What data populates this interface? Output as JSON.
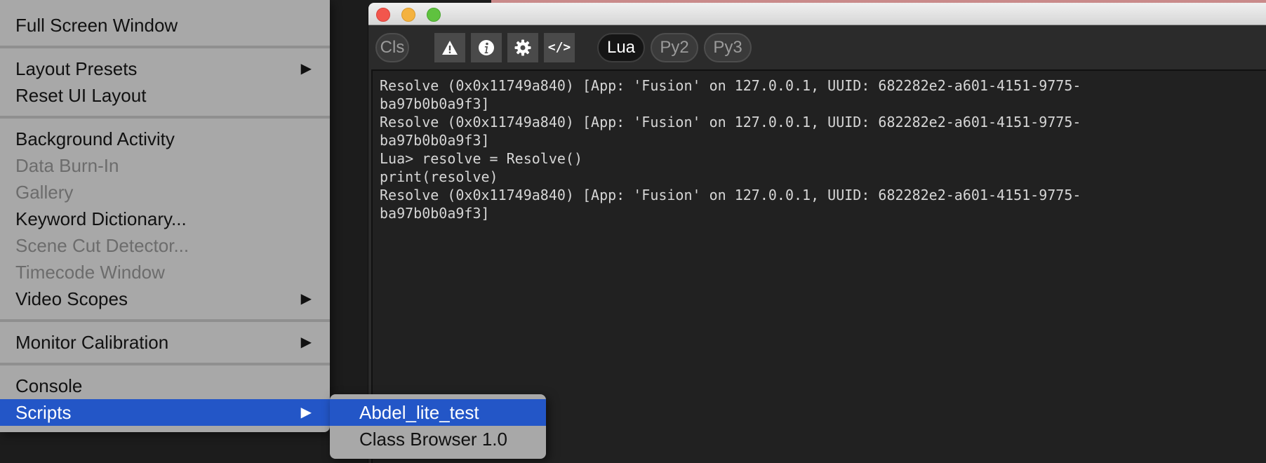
{
  "menu": {
    "items": [
      {
        "label": "Full Screen Window",
        "enabled": true
      },
      {
        "label": "Layout Presets",
        "enabled": true,
        "submenu_arrow": "▶"
      },
      {
        "label": "Reset UI Layout",
        "enabled": true
      },
      {
        "label": "Background Activity",
        "enabled": true
      },
      {
        "label": "Data Burn-In",
        "enabled": false
      },
      {
        "label": "Gallery",
        "enabled": false
      },
      {
        "label": "Keyword Dictionary...",
        "enabled": true
      },
      {
        "label": "Scene Cut Detector...",
        "enabled": false
      },
      {
        "label": "Timecode Window",
        "enabled": false
      },
      {
        "label": "Video Scopes",
        "enabled": true,
        "submenu_arrow": "▶"
      },
      {
        "label": "Monitor Calibration",
        "enabled": true,
        "submenu_arrow": "▶"
      },
      {
        "label": "Console",
        "enabled": true
      },
      {
        "label": "Scripts",
        "enabled": true,
        "selected": true,
        "submenu_arrow": "▶"
      }
    ]
  },
  "submenu": {
    "items": [
      {
        "label": "Abdel_lite_test",
        "selected": true
      },
      {
        "label": "Class Browser 1.0",
        "selected": false
      }
    ]
  },
  "console_window": {
    "toolbar": {
      "cls_label": "Cls",
      "warning_icon": "warning-icon",
      "info_icon": "info-icon",
      "settings_icon": "gear-icon",
      "code_icon": "code-icon",
      "code_label": "</>",
      "languages": [
        {
          "label": "Lua",
          "active": true
        },
        {
          "label": "Py2",
          "active": false
        },
        {
          "label": "Py3",
          "active": false
        }
      ]
    },
    "output_lines": [
      "Resolve (0x0x11749a840) [App: 'Fusion' on 127.0.0.1, UUID: 682282e2-a601-4151-9775-",
      "ba97b0b0a9f3]",
      "Resolve (0x0x11749a840) [App: 'Fusion' on 127.0.0.1, UUID: 682282e2-a601-4151-9775-",
      "ba97b0b0a9f3]",
      "Lua> resolve = Resolve()",
      "print(resolve)",
      "Resolve (0x0x11749a840) [App: 'Fusion' on 127.0.0.1, UUID: 682282e2-a601-4151-9775-",
      "ba97b0b0a9f3]"
    ]
  },
  "colors": {
    "menu_bg": "#a8a8a8",
    "selection": "#2356c7",
    "console_bg": "#212121",
    "console_text": "#d6d6d6"
  }
}
